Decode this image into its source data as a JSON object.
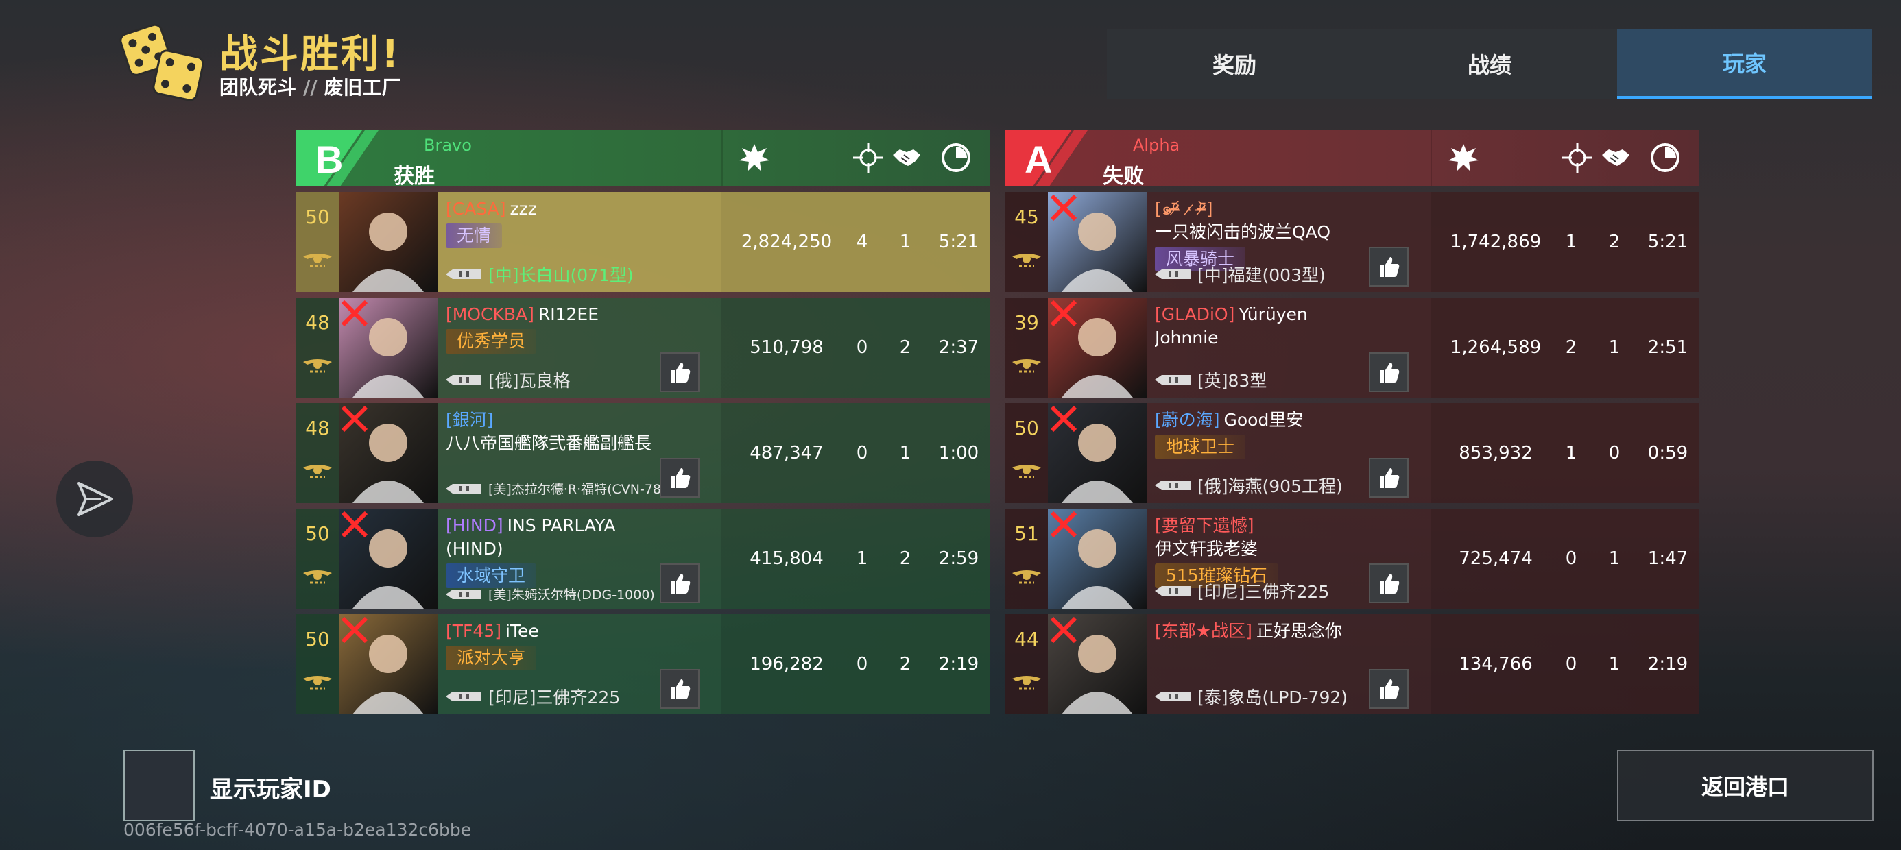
{
  "header": {
    "title": "战斗胜利!",
    "mode": "团队死斗",
    "separator": "//",
    "map": "废旧工厂"
  },
  "tabs": [
    {
      "label": "奖励",
      "active": false
    },
    {
      "label": "战绩",
      "active": false
    },
    {
      "label": "玩家",
      "active": true
    }
  ],
  "columns": {
    "score_icon": "explosion-icon",
    "kills_icon": "crosshair-icon",
    "assists_icon": "handshake-icon",
    "time_icon": "clock-icon"
  },
  "teams": [
    {
      "letter": "B",
      "name": "Bravo",
      "result": "获胜",
      "accent": "#3fd36a",
      "players": [
        {
          "level": "50",
          "clan": "[CASA]",
          "clan_color": "#ff6a3d",
          "name": "zzz",
          "title": "无情",
          "title_style": "purple",
          "ship": "[中]长白山(071型)",
          "ship_color": "#5df07a",
          "score": "2,824,250",
          "kills": "4",
          "assists": "1",
          "time": "5:21",
          "destroyed": false,
          "self": true,
          "liked": false,
          "avatar": "#6b3a24"
        },
        {
          "level": "48",
          "clan": "[MOCKBA]",
          "clan_color": "#ff5a5a",
          "name": "RI12EE",
          "title": "优秀学员",
          "title_style": "orange",
          "ship": "[俄]瓦良格",
          "ship_color": "#e8e8e8",
          "score": "510,798",
          "kills": "0",
          "assists": "2",
          "time": "2:37",
          "destroyed": true,
          "self": false,
          "liked": true,
          "avatar": "#c48bb0"
        },
        {
          "level": "48",
          "clan": "[銀河]",
          "clan_color": "#5aa8ff",
          "name": "",
          "name_line2": "八八帝国艦隊弐番艦副艦長",
          "title": "",
          "title_style": "",
          "ship": "[美]杰拉尔德·R·福特(CVN-78)",
          "ship_color": "#e8e8e8",
          "ship_small": true,
          "score": "487,347",
          "kills": "0",
          "assists": "1",
          "time": "1:00",
          "destroyed": true,
          "self": false,
          "liked": true,
          "avatar": "#3a342c"
        },
        {
          "level": "50",
          "clan": "[HIND]",
          "clan_color": "#b07cff",
          "name": "INS PARLAYA",
          "name_line2": "(HIND)",
          "title": "水域守卫",
          "title_style": "blue",
          "ship": "[美]朱姆沃尔特(DDG-1000)",
          "ship_color": "#e8e8e8",
          "ship_small": true,
          "score": "415,804",
          "kills": "1",
          "assists": "2",
          "time": "2:59",
          "destroyed": true,
          "self": false,
          "liked": true,
          "avatar": "#25303c"
        },
        {
          "level": "50",
          "clan": "[TF45]",
          "clan_color": "#ff5a5a",
          "name": "iTee",
          "title": "派对大亨",
          "title_style": "orange",
          "ship": "[印尼]三佛齐225",
          "ship_color": "#e8e8e8",
          "score": "196,282",
          "kills": "0",
          "assists": "2",
          "time": "2:19",
          "destroyed": true,
          "self": false,
          "liked": true,
          "avatar": "#8a6a3a"
        }
      ]
    },
    {
      "letter": "A",
      "name": "Alpha",
      "result": "失败",
      "accent": "#e8343e",
      "players": [
        {
          "level": "45",
          "clan": "[๑ᵒ̴̶̷᷄ ˔̷ ᵒ̴̶̷᷅]",
          "clan_color": "#ff9a6a",
          "name": "",
          "name_line2": "一只被闪击的波兰QAQ",
          "title": "风暴骑士",
          "title_style": "purple",
          "ship": "[中]福建(003型)",
          "ship_color": "#e8e8e8",
          "score": "1,742,869",
          "kills": "1",
          "assists": "2",
          "time": "5:21",
          "destroyed": true,
          "self": false,
          "liked": true,
          "avatar": "#8ea9d8"
        },
        {
          "level": "39",
          "clan": "[GLADiO]",
          "clan_color": "#ff5a5a",
          "name": "Yürüyen",
          "name_line2": "Johnnie",
          "title": "",
          "title_style": "",
          "ship": "[英]83型",
          "ship_color": "#e8e8e8",
          "score": "1,264,589",
          "kills": "2",
          "assists": "1",
          "time": "2:51",
          "destroyed": true,
          "self": false,
          "liked": true,
          "avatar": "#9a3a34"
        },
        {
          "level": "50",
          "clan": "[蔚の海]",
          "clan_color": "#5aa8ff",
          "name": "Good里安",
          "title": "地球卫士",
          "title_style": "orange",
          "ship": "[俄]海燕(905工程)",
          "ship_color": "#e8e8e8",
          "score": "853,932",
          "kills": "1",
          "assists": "0",
          "time": "0:59",
          "destroyed": true,
          "self": false,
          "liked": true,
          "avatar": "#2c2f36"
        },
        {
          "level": "51",
          "clan": "[要留下遗憾]",
          "clan_color": "#ff5a5a",
          "name": "",
          "name_line2": "伊文轩我老婆",
          "title": "515璀璨钻石",
          "title_style": "orange",
          "ship": "[印尼]三佛齐225",
          "ship_color": "#e8e8e8",
          "score": "725,474",
          "kills": "0",
          "assists": "1",
          "time": "1:47",
          "destroyed": true,
          "self": false,
          "liked": true,
          "avatar": "#5a7fa8"
        },
        {
          "level": "44",
          "clan": "[东部★战区]",
          "clan_color": "#ff5a5a",
          "name": "正好思念你",
          "title": "",
          "title_style": "",
          "ship": "[泰]象岛(LPD-792)",
          "ship_color": "#e8e8e8",
          "score": "134,766",
          "kills": "0",
          "assists": "1",
          "time": "2:19",
          "destroyed": true,
          "self": false,
          "liked": true,
          "avatar": "#4a4440"
        }
      ]
    }
  ],
  "footer": {
    "show_id_label": "显示玩家ID",
    "player_id": "006fe56f-bcff-4070-a15a-b2ea132c6bbe",
    "back_label": "返回港口"
  }
}
